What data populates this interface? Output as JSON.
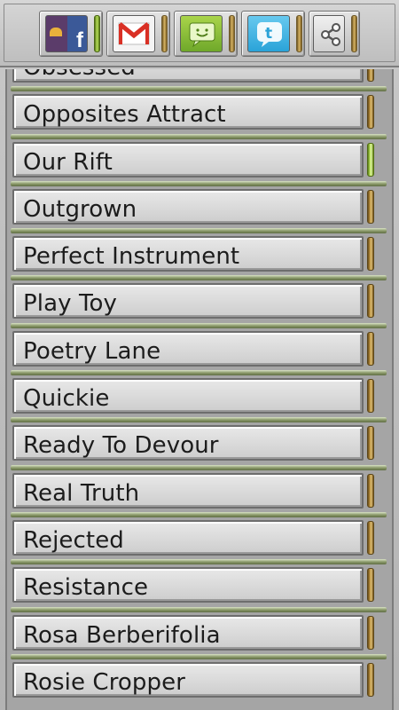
{
  "share_bar": {
    "buttons": [
      {
        "name": "facebook",
        "icon": "facebook-icon",
        "f_letter": "f",
        "active": true
      },
      {
        "name": "gmail",
        "icon": "gmail-icon",
        "active": false
      },
      {
        "name": "sms",
        "icon": "sms-icon",
        "active": false
      },
      {
        "name": "twitter",
        "icon": "twitter-icon",
        "t_letter": "t",
        "active": false
      },
      {
        "name": "share",
        "icon": "share-icon",
        "active": false
      }
    ]
  },
  "list": {
    "items": [
      {
        "label": "Obsessed",
        "active": false
      },
      {
        "label": "Opposites Attract",
        "active": false
      },
      {
        "label": "Our Rift",
        "active": true
      },
      {
        "label": "Outgrown",
        "active": false
      },
      {
        "label": "Perfect Instrument",
        "active": false
      },
      {
        "label": "Play Toy",
        "active": false
      },
      {
        "label": "Poetry Lane",
        "active": false
      },
      {
        "label": "Quickie",
        "active": false
      },
      {
        "label": "Ready To Devour",
        "active": false
      },
      {
        "label": "Real Truth",
        "active": false
      },
      {
        "label": "Rejected",
        "active": false
      },
      {
        "label": "Resistance",
        "active": false
      },
      {
        "label": "Rosa Berberifolia",
        "active": false
      },
      {
        "label": "Rosie Cropper",
        "active": false
      }
    ]
  },
  "colors": {
    "active_handle": "#b7e05a",
    "inactive_handle": "#c79e4a",
    "facebook": "#3b5998",
    "twitter": "#2aa3d8",
    "sms": "#8cc63f",
    "gmail_red": "#d93025"
  }
}
